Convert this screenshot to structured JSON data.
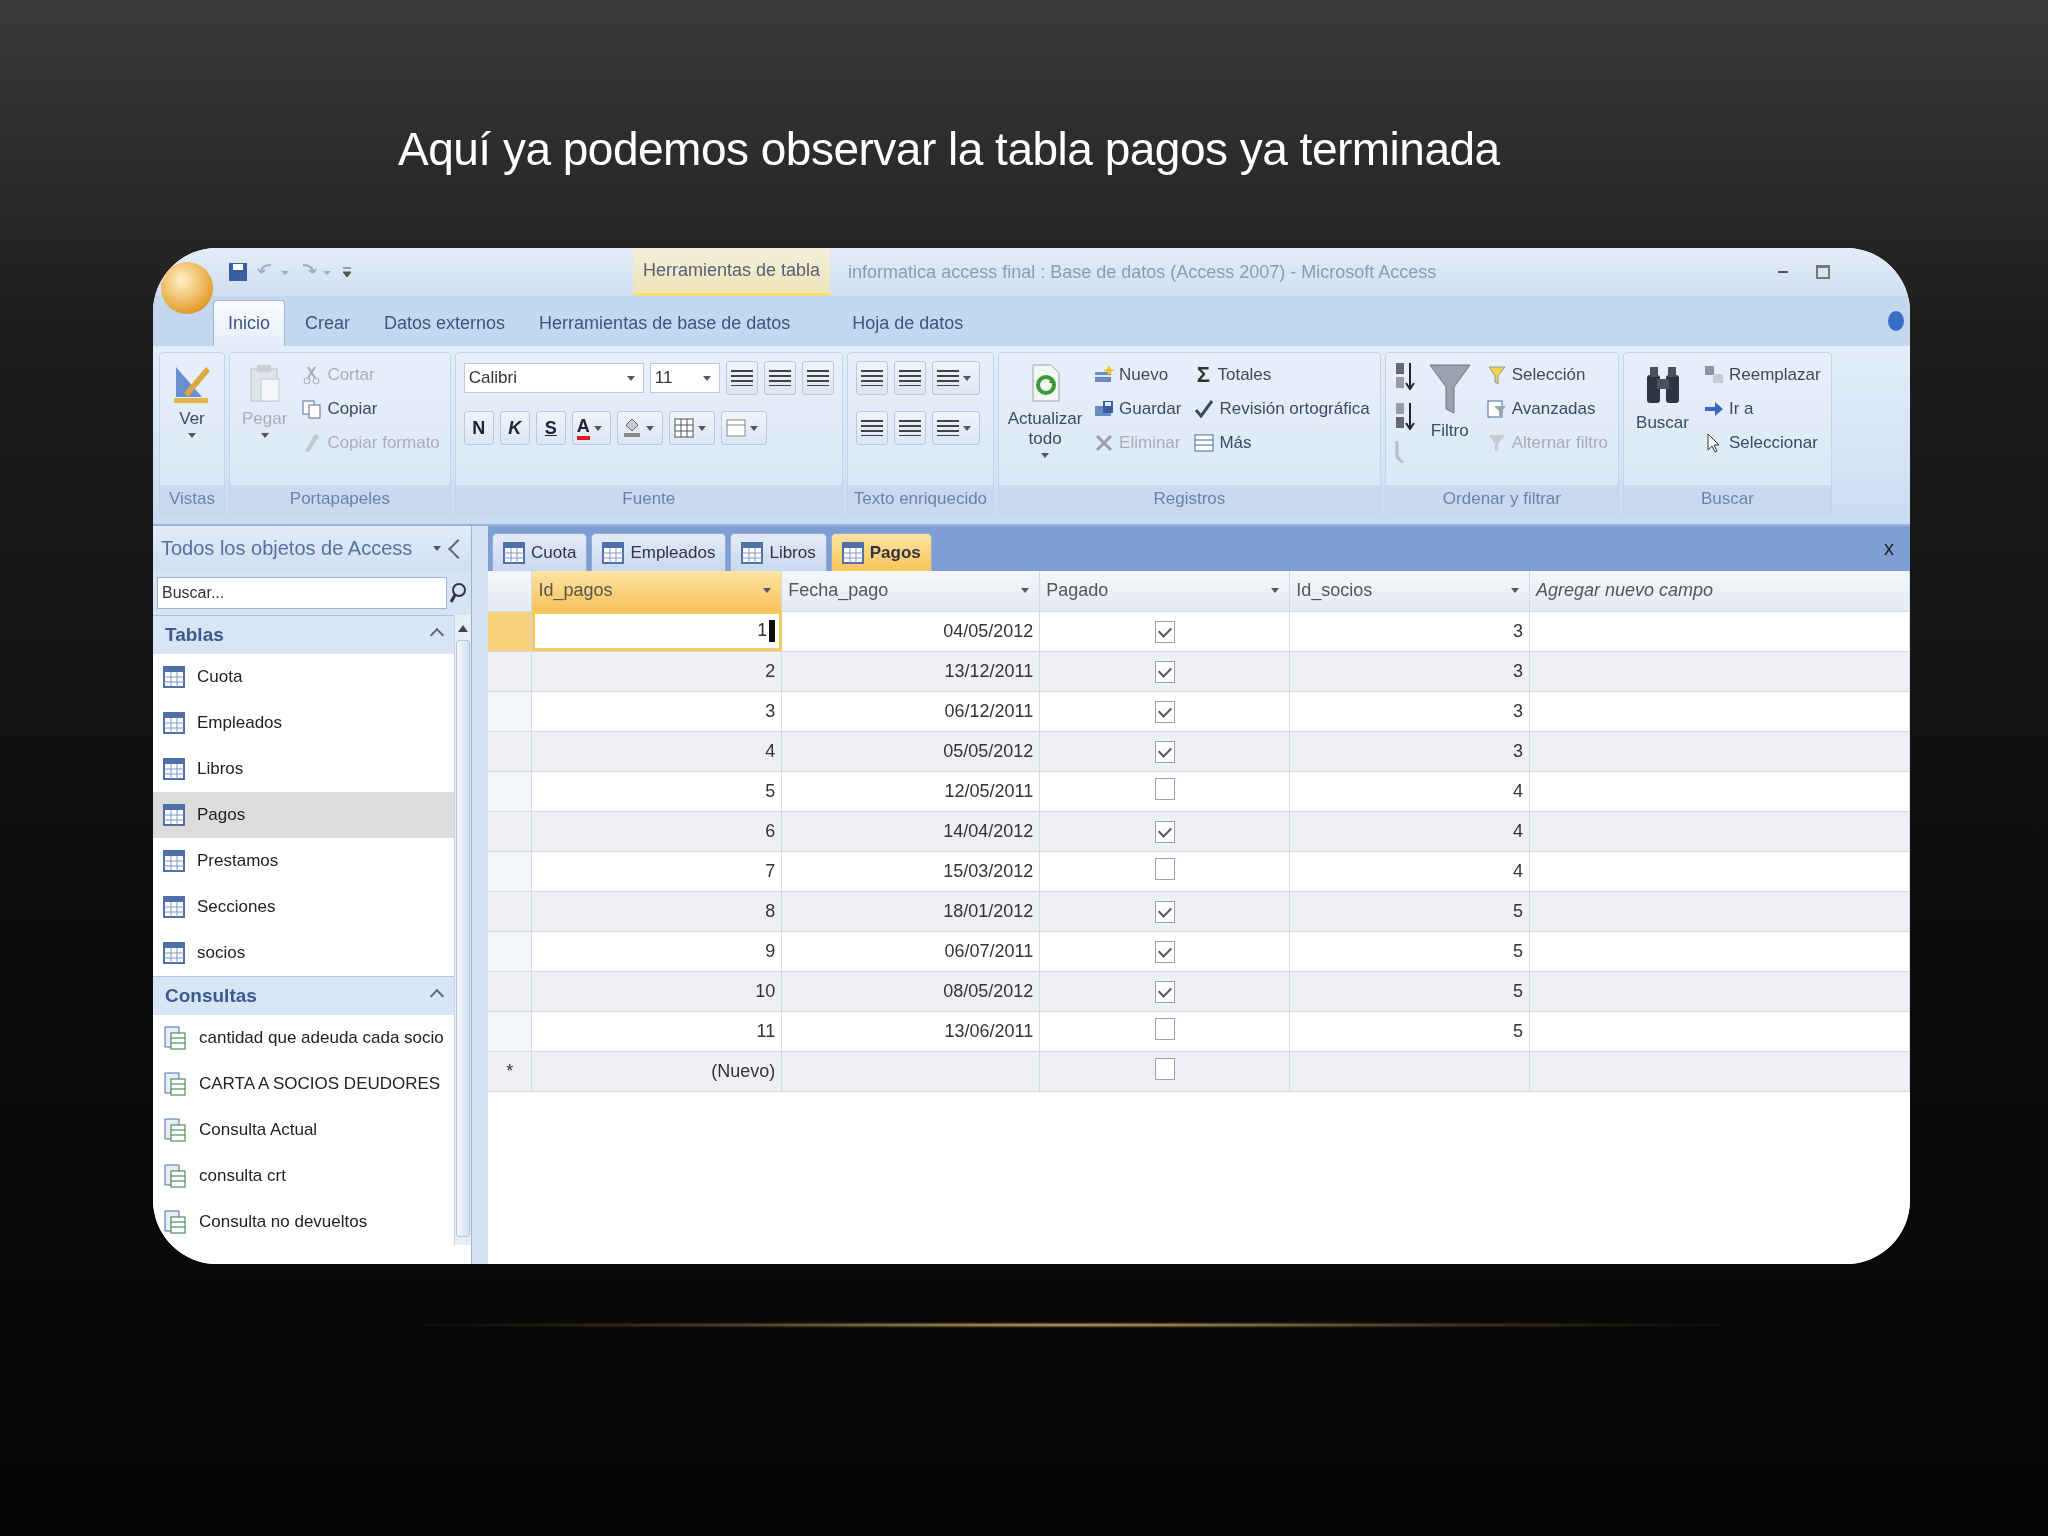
{
  "slide_title": "Aquí ya podemos observar la tabla pagos ya terminada",
  "window": {
    "context_tab": "Herramientas de tabla",
    "title": "informatica access final : Base de datos (Access 2007) - Microsoft Access"
  },
  "ribbon_tabs": [
    {
      "label": "Inicio",
      "selected": true
    },
    {
      "label": "Crear",
      "selected": false
    },
    {
      "label": "Datos externos",
      "selected": false
    },
    {
      "label": "Herramientas de base de datos",
      "selected": false
    },
    {
      "label": "Hoja de datos",
      "selected": false
    }
  ],
  "ribbon_groups": [
    {
      "kind": "buttons",
      "label": "Vistas",
      "large": [
        {
          "label": "Ver",
          "disabled": false
        }
      ]
    },
    {
      "kind": "buttons",
      "label": "Portapapeles",
      "large": [
        {
          "label": "Pegar",
          "disabled": true
        }
      ],
      "small": [
        [
          {
            "label": "Cortar",
            "disabled": true
          },
          {
            "label": "Copiar",
            "disabled": false
          },
          {
            "label": "Copiar formato",
            "disabled": true
          }
        ]
      ]
    },
    {
      "kind": "font",
      "label": "Fuente",
      "font": "Calibri",
      "size": "11",
      "format_buttons": [
        "N",
        "K",
        "S"
      ],
      "color_letter": "A"
    },
    {
      "kind": "rich_text",
      "label": "Texto enriquecido"
    },
    {
      "kind": "buttons",
      "label": "Registros",
      "large": [
        {
          "label": "Actualizar todo",
          "disabled": false
        }
      ],
      "small": [
        [
          {
            "label": "Nuevo",
            "disabled": false
          },
          {
            "label": "Guardar",
            "disabled": false
          },
          {
            "label": "Eliminar",
            "disabled": true
          }
        ],
        [
          {
            "label": "Totales",
            "symbol": "Σ",
            "disabled": false
          },
          {
            "label": "Revisión ortográfica",
            "disabled": false
          },
          {
            "label": "Más",
            "disabled": false
          }
        ]
      ]
    },
    {
      "kind": "sort",
      "label": "Ordenar y filtrar",
      "large": [
        {
          "label": "Filtro",
          "disabled": false
        }
      ],
      "small": [
        [
          {
            "label": "Selección",
            "disabled": false
          },
          {
            "label": "Avanzadas",
            "disabled": false
          },
          {
            "label": "Alternar filtro",
            "disabled": true
          }
        ]
      ]
    },
    {
      "kind": "buttons",
      "label": "Buscar",
      "large": [
        {
          "label": "Buscar",
          "disabled": false
        }
      ],
      "small": [
        [
          {
            "label": "Reemplazar",
            "disabled": false
          },
          {
            "label": "Ir a",
            "disabled": false
          },
          {
            "label": "Seleccionar",
            "disabled": false
          }
        ]
      ]
    }
  ],
  "nav_pane": {
    "title": "Todos los objetos de Access",
    "search": {
      "placeholder": "Buscar..."
    },
    "sections": [
      {
        "title": "Tablas",
        "kind": "table",
        "items": [
          {
            "label": "Cuota",
            "selected": false
          },
          {
            "label": "Empleados",
            "selected": false
          },
          {
            "label": "Libros",
            "selected": false
          },
          {
            "label": "Pagos",
            "selected": true
          },
          {
            "label": "Prestamos",
            "selected": false
          },
          {
            "label": "Secciones",
            "selected": false
          },
          {
            "label": "socios",
            "selected": false
          }
        ]
      },
      {
        "title": "Consultas",
        "kind": "query",
        "items": [
          {
            "label": "cantidad que adeuda cada socio",
            "selected": false
          },
          {
            "label": "CARTA A SOCIOS DEUDORES",
            "selected": false
          },
          {
            "label": "Consulta Actual",
            "selected": false
          },
          {
            "label": "consulta crt",
            "selected": false
          },
          {
            "label": "Consulta no devueltos",
            "selected": false
          }
        ]
      }
    ]
  },
  "doc_tabs": [
    {
      "label": "Cuota",
      "selected": false
    },
    {
      "label": "Empleados",
      "selected": false
    },
    {
      "label": "Libros",
      "selected": false
    },
    {
      "label": "Pagos",
      "selected": true
    }
  ],
  "close_label": "x",
  "table": {
    "columns": [
      {
        "label": "Id_pagos",
        "selected": true
      },
      {
        "label": "Fecha_pago",
        "selected": false
      },
      {
        "label": "Pagado",
        "selected": false
      },
      {
        "label": "Id_socios",
        "selected": false
      },
      {
        "label": "Agregar nuevo campo",
        "selected": false
      }
    ],
    "rows": [
      {
        "id": "1",
        "fecha": "04/05/2012",
        "pagado": true,
        "socio": "3",
        "selected": true
      },
      {
        "id": "2",
        "fecha": "13/12/2011",
        "pagado": true,
        "socio": "3",
        "selected": false
      },
      {
        "id": "3",
        "fecha": "06/12/2011",
        "pagado": true,
        "socio": "3",
        "selected": false
      },
      {
        "id": "4",
        "fecha": "05/05/2012",
        "pagado": true,
        "socio": "3",
        "selected": false
      },
      {
        "id": "5",
        "fecha": "12/05/2011",
        "pagado": false,
        "socio": "4",
        "selected": false
      },
      {
        "id": "6",
        "fecha": "14/04/2012",
        "pagado": true,
        "socio": "4",
        "selected": false
      },
      {
        "id": "7",
        "fecha": "15/03/2012",
        "pagado": false,
        "socio": "4",
        "selected": false
      },
      {
        "id": "8",
        "fecha": "18/01/2012",
        "pagado": true,
        "socio": "5",
        "selected": false
      },
      {
        "id": "9",
        "fecha": "06/07/2011",
        "pagado": true,
        "socio": "5",
        "selected": false
      },
      {
        "id": "10",
        "fecha": "08/05/2012",
        "pagado": true,
        "socio": "5",
        "selected": false
      },
      {
        "id": "11",
        "fecha": "13/06/2011",
        "pagado": false,
        "socio": "5",
        "selected": false
      }
    ],
    "new_row": {
      "marker": "*",
      "label": "(Nuevo)",
      "pagado": false
    }
  }
}
